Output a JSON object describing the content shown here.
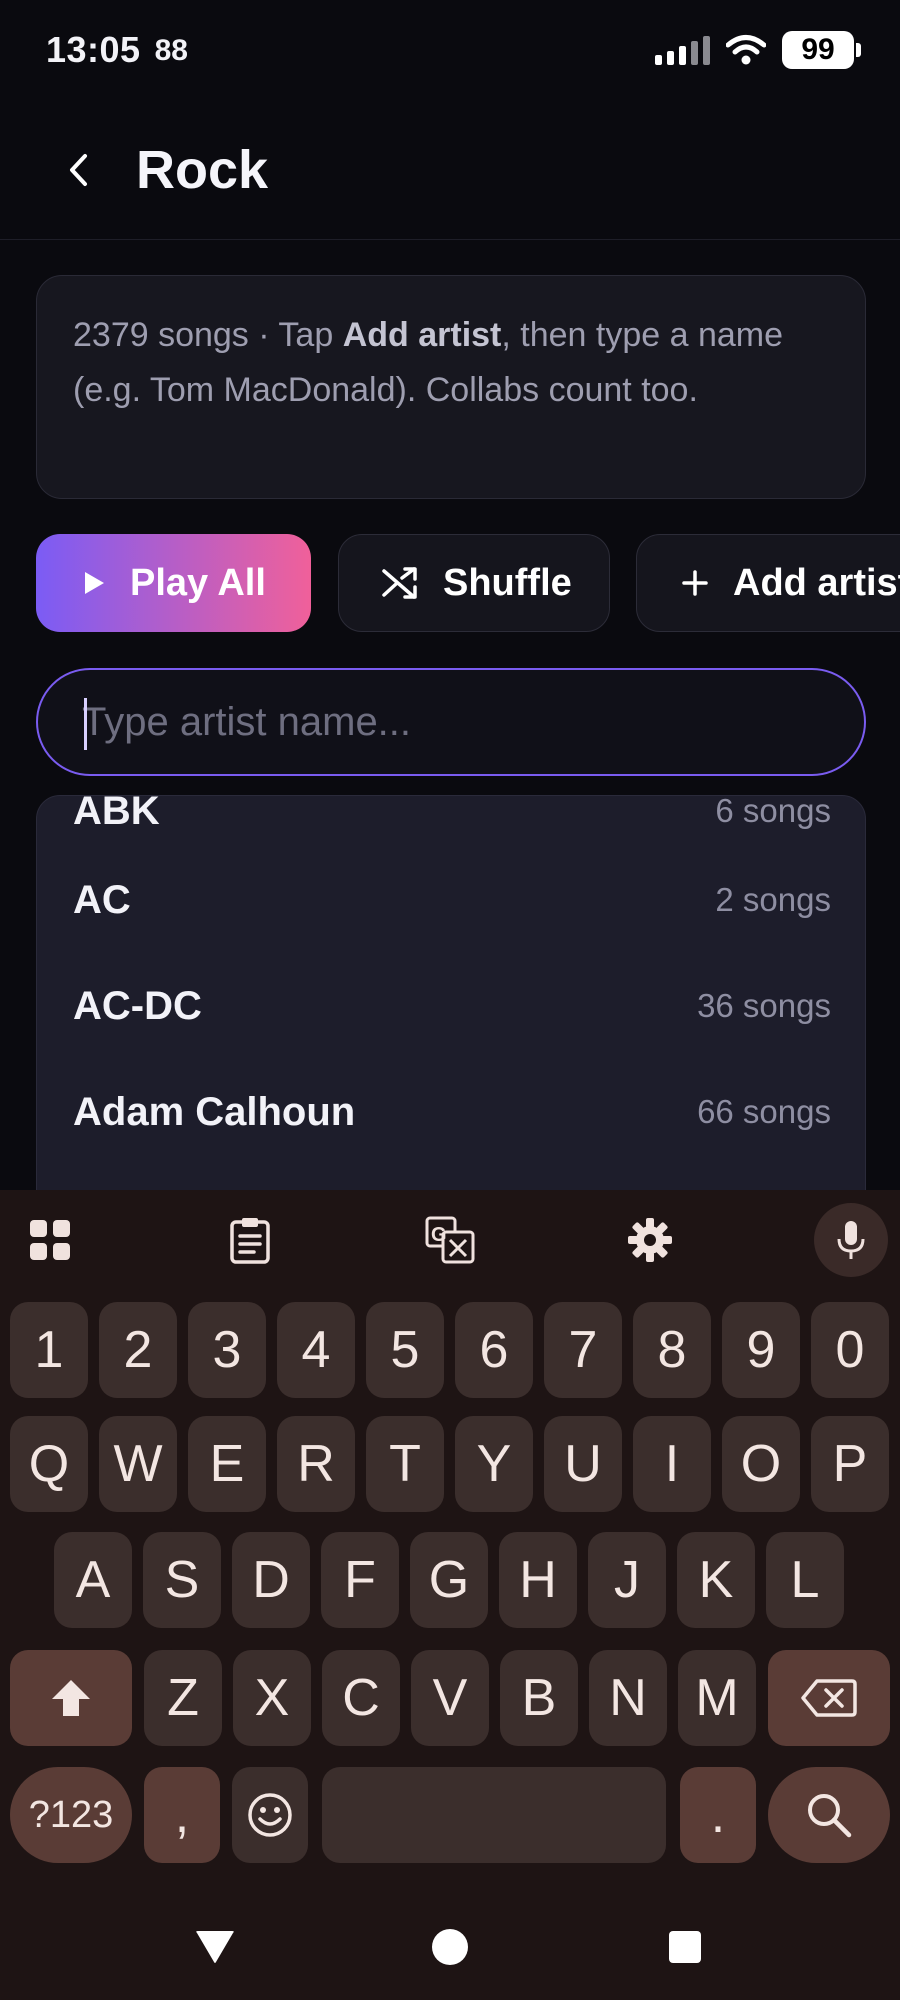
{
  "status_bar": {
    "time": "13:05",
    "extra": "88",
    "battery": "99"
  },
  "header": {
    "back_icon": "chevron-left-icon",
    "title": "Rock"
  },
  "info": {
    "prefix": "2379 songs · Tap ",
    "bold": "Add artist",
    "suffix": ", then type a name (e.g. Tom MacDonald). Collabs count too."
  },
  "actions": {
    "play_all": "Play All",
    "shuffle": "Shuffle",
    "add_artist": "Add artist"
  },
  "search": {
    "placeholder": "Type artist name...",
    "value": ""
  },
  "artists": [
    {
      "name": "ABK",
      "count": "6 songs"
    },
    {
      "name": "AC",
      "count": "2 songs"
    },
    {
      "name": "AC-DC",
      "count": "36 songs"
    },
    {
      "name": "Adam Calhoun",
      "count": "66 songs"
    }
  ],
  "keyboard": {
    "row_numbers": [
      "1",
      "2",
      "3",
      "4",
      "5",
      "6",
      "7",
      "8",
      "9",
      "0"
    ],
    "row_top": [
      "Q",
      "W",
      "E",
      "R",
      "T",
      "Y",
      "U",
      "I",
      "O",
      "P"
    ],
    "row_mid": [
      "A",
      "S",
      "D",
      "F",
      "G",
      "H",
      "J",
      "K",
      "L"
    ],
    "row_bottom": [
      "Z",
      "X",
      "C",
      "V",
      "B",
      "N",
      "M"
    ],
    "symbols_label": "?123",
    "comma": ",",
    "period": "."
  },
  "colors": {
    "accent_start": "#7b5cf5",
    "accent_end": "#f0609a",
    "input_border": "#7a5cf0"
  }
}
